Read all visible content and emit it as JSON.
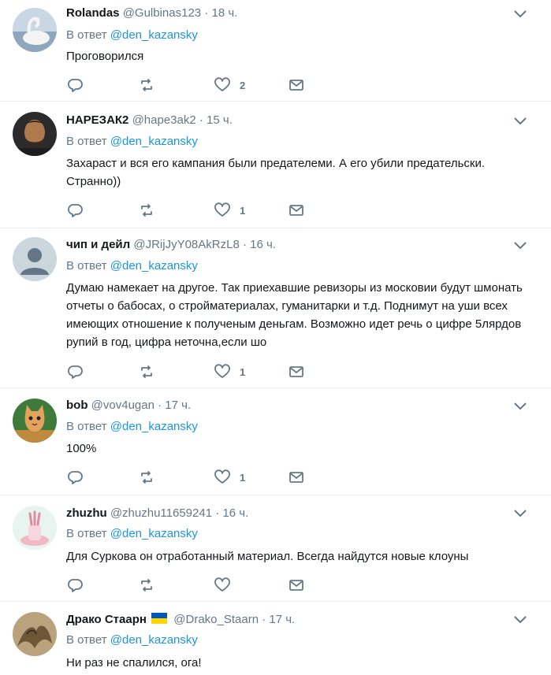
{
  "reply_prefix": "В ответ",
  "reply_mention": "@den_kazansky",
  "tweets": [
    {
      "name": "Rolandas",
      "handle": "@Gulbinas123",
      "sep": "·",
      "time": "18 ч.",
      "text": "Проговорился",
      "likes": "2"
    },
    {
      "name": "НАРЕЗАК2",
      "handle": "@hape3ak2",
      "sep": "·",
      "time": "15 ч.",
      "text": "Захараст и вся его кампания были предателеми. А его убили предательски. Странно))",
      "likes": "1"
    },
    {
      "name": "чип и дейл",
      "handle": "@JRijJyY08AkRzL8",
      "sep": "·",
      "time": "16 ч.",
      "text": "Думаю намекает на другое. Так приехавшие ревизоры из московии будут шмонать отчеты о бабосах, о стройматериалах, гуманитарки и т.д. Поднимут на уши всех имеющих отношение к полученым деньгам. Возможно идет речь о цифре 5лярдов рупий в год, цифра неточна,если шо",
      "likes": "1"
    },
    {
      "name": "bob",
      "handle": "@vov4ugan",
      "sep": "·",
      "time": "17 ч.",
      "text": "100%",
      "likes": "1"
    },
    {
      "name": "zhuzhu",
      "handle": "@zhuzhu11659241",
      "sep": "·",
      "time": "16 ч.",
      "text": "Для Суркова он отработанный материал. Всегда найдутся новые клоуны",
      "likes": ""
    },
    {
      "name": "Драко Стаарн",
      "handle": "@Drako_Staarn",
      "sep": "·",
      "time": "17 ч.",
      "text": "Ни раз не спалился, ога!",
      "likes": "",
      "flag": "ukraine-flag-icon"
    }
  ],
  "icons": {
    "reply": "reply-icon",
    "retweet": "retweet-icon",
    "like": "like-icon",
    "message": "direct-message-icon",
    "more": "chevron-down-icon"
  },
  "colors": {
    "name": "#14171a",
    "meta": "#657786",
    "link": "#1b95e0",
    "divider": "#e6ecf0",
    "flag_blue": "#0057b7",
    "flag_yellow": "#ffd700"
  }
}
